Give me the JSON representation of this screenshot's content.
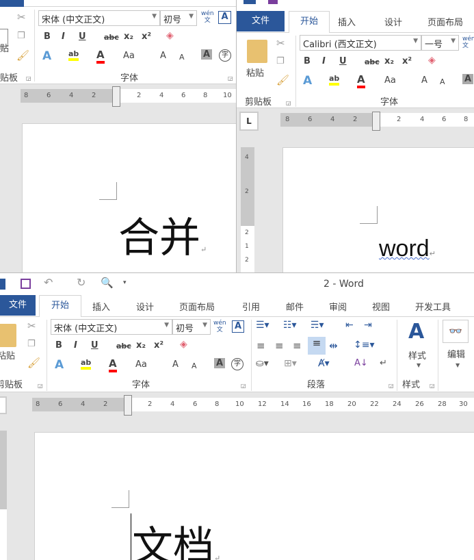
{
  "colors": {
    "accent": "#2b579a",
    "file_tab": "#2b579a",
    "highlight": "#ffff00",
    "font_color": "#ff0000"
  },
  "left_window": {
    "font_name": "宋体 (中文正文)",
    "font_size": "初号",
    "paste_label_partial": "贴",
    "clipboard_label_partial": "贴板",
    "font_group": "字体",
    "ruler": [
      "8",
      "6",
      "4",
      "2",
      "2",
      "4",
      "6",
      "8",
      "10"
    ],
    "doc_text": "合并"
  },
  "right_window": {
    "tabs": [
      "文件",
      "开始",
      "插入",
      "设计",
      "页面布局"
    ],
    "font_name": "Calibri (西文正文)",
    "font_size": "一号",
    "paste_label": "粘贴",
    "clipboard_group": "剪贴板",
    "font_group": "字体",
    "tab_selector": "L",
    "ruler": [
      "8",
      "6",
      "4",
      "2",
      "2",
      "4",
      "6",
      "8"
    ],
    "vruler": [
      "4",
      "2",
      "2",
      "1",
      "2"
    ],
    "doc_text": "word"
  },
  "bottom_window": {
    "title": "2 - Word",
    "tabs": [
      "文件",
      "开始",
      "插入",
      "设计",
      "页面布局",
      "引用",
      "邮件",
      "审阅",
      "视图",
      "开发工具"
    ],
    "font_name": "宋体 (中文正文)",
    "font_size": "初号",
    "paste_label": "粘贴",
    "clipboard_group": "剪贴板",
    "font_group": "字体",
    "paragraph_group": "段落",
    "styles_label": "样式",
    "styles_group": "样式",
    "editing_label": "编辑",
    "ruler": [
      "8",
      "6",
      "4",
      "2",
      "2",
      "4",
      "6",
      "8",
      "10",
      "12",
      "14",
      "16",
      "18",
      "20",
      "22",
      "24",
      "26",
      "28",
      "30"
    ],
    "doc_text": "文档"
  },
  "glyphs": {
    "bold": "B",
    "italic": "I",
    "underline": "U",
    "strike": "abc",
    "sub": "x₂",
    "sup": "x²",
    "case": "Aa",
    "grow": "A",
    "shrink": "A",
    "phonetic_top": "wén",
    "phonetic_bottom": "文",
    "border_char": "A",
    "shade_char": "A",
    "enclose": "字",
    "texteffect": "A",
    "fontcolor": "A",
    "highlight": "ab",
    "para": "↵"
  }
}
